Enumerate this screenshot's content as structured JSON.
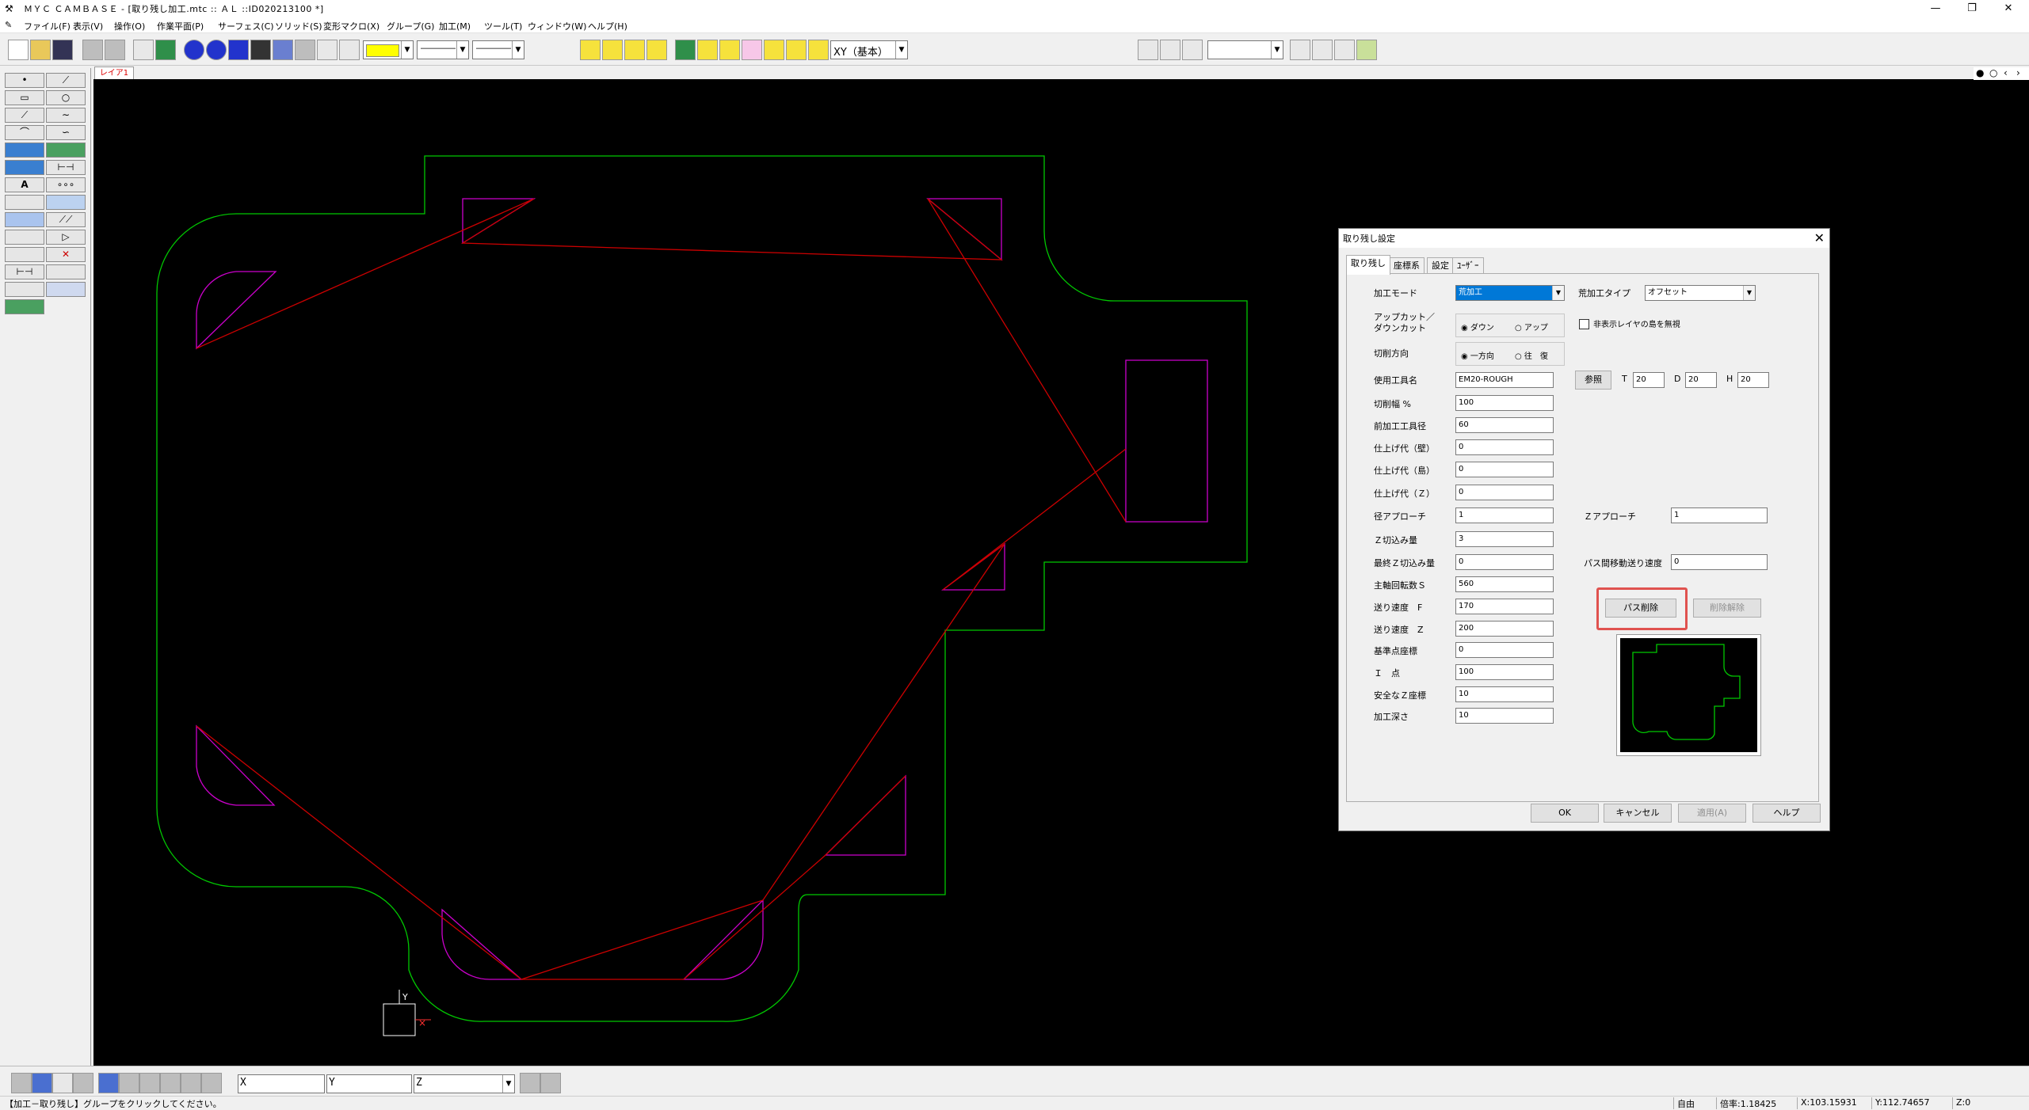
{
  "window": {
    "title": "ＭＹＣ ＣＡＭＢＡＳＥ - [取り残し加工.mtc :: ＡＬ ::ID020213100 *]",
    "minimize": "—",
    "restore": "❐",
    "close": "✕"
  },
  "menu": [
    "ファイル(F)",
    "表示(V)",
    "操作(O)",
    "作業平面(P)",
    "サーフェス(C)",
    "ソリッド(S)",
    "変形マクロ(X)",
    "グループ(G)",
    "加工(M)",
    "ツール(T)",
    "ウィンドウ(W)",
    "ヘルプ(H)"
  ],
  "toolbar": {
    "view_select": "XY（基本）",
    "line_style_1": "――――",
    "line_style_2": "――――"
  },
  "layer_tab": "レイア1",
  "palette": {
    "text_tool_glyph": "A",
    "delete_glyph": "✕"
  },
  "canvas": {
    "background": "#000000",
    "contour_color": "#00c800",
    "region_color": "#cc00cc",
    "path_color": "#cc0000",
    "axis_y_label": "Y"
  },
  "bottombar": {
    "x_label": "X",
    "y_label": "Y",
    "z_label": "Z"
  },
  "status": {
    "message": "【加工－取り残し】グループをクリックしてください。",
    "mode": "自由",
    "scale": "倍率:1.18425",
    "x": "X:103.15931",
    "y": "Y:112.74657",
    "z": "Z:0"
  },
  "dialog": {
    "title": "取り残し設定",
    "close": "✕",
    "tabs": [
      "取り残し",
      "座標系",
      "設定",
      "ﾕｰｻﾞｰ"
    ],
    "mode_label": "加工モード",
    "mode_value": "荒加工",
    "finish_type_label": "荒加工タイプ",
    "finish_type_value": "オフセット",
    "updown_label": "アップカット／\nダウンカット",
    "updown_options": [
      "ダウン",
      "アップ"
    ],
    "hide_layer_label": "非表示レイヤの島を無視",
    "direction_label": "切削方向",
    "direction_options": [
      "一方向",
      "往　復"
    ],
    "tool_name_label": "使用工具名",
    "tool_name_value": "EM20-ROUGH",
    "ref_button": "参照",
    "t_label": "T",
    "t_value": "20",
    "d_label": "D",
    "d_value": "20",
    "h_label": "H",
    "h_value": "20",
    "fields": [
      {
        "label": "切削幅 %",
        "value": "100"
      },
      {
        "label": "前加工工具径",
        "value": "60"
      },
      {
        "label": "仕上げ代（壁）",
        "value": "0"
      },
      {
        "label": "仕上げ代（島）",
        "value": "0"
      },
      {
        "label": "仕上げ代（Ｚ）",
        "value": "0"
      },
      {
        "label": "径アプローチ",
        "value": "1"
      },
      {
        "label": "Ｚ切込み量",
        "value": "3"
      },
      {
        "label": "最終Ｚ切込み量",
        "value": "0"
      },
      {
        "label": "主軸回転数Ｓ",
        "value": "560"
      },
      {
        "label": "送り速度　F",
        "value": "170"
      },
      {
        "label": "送り速度　Z",
        "value": "200"
      },
      {
        "label": "基準点座標",
        "value": "0"
      },
      {
        "label": "Ｉ　点",
        "value": "100"
      },
      {
        "label": "安全なＺ座標",
        "value": "10"
      },
      {
        "label": "加工深さ",
        "value": "10"
      }
    ],
    "z_approach_label": "Ｚアプローチ",
    "z_approach_value": "1",
    "pass_feed_label": "パス間移動送り速度",
    "pass_feed_value": "0",
    "path_delete_button": "パス削除",
    "undo_delete_button": "削除解除",
    "ok": "OK",
    "cancel": "キャンセル",
    "apply": "適用(A)",
    "help": "ヘルプ"
  }
}
